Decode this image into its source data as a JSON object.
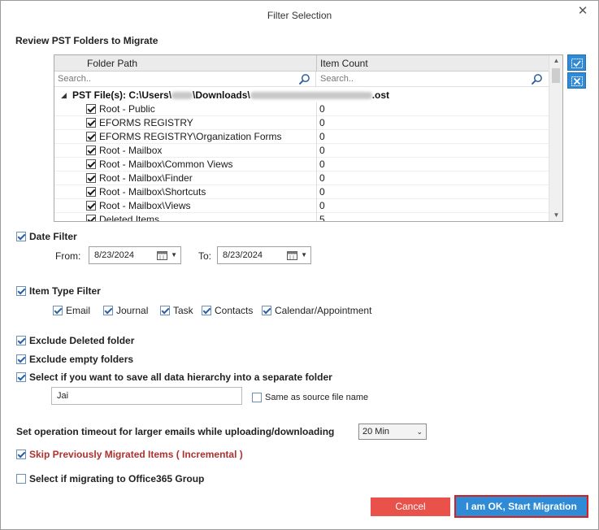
{
  "dialog": {
    "title": "Filter Selection",
    "close_glyph": "✕"
  },
  "review": {
    "title": "Review PST Folders to Migrate",
    "columns": {
      "folder": "Folder Path",
      "count": "Item Count"
    },
    "search_placeholder_folder": "Search..",
    "search_placeholder_count": "Search..",
    "root_label": "PST File(s): C:\\Users\\",
    "root_mid": "\\Downloads\\",
    "root_ext": ".ost",
    "rows": [
      {
        "name": "Root - Public",
        "count": "0",
        "checked": true
      },
      {
        "name": "EFORMS REGISTRY",
        "count": "0",
        "checked": true
      },
      {
        "name": "EFORMS REGISTRY\\Organization Forms",
        "count": "0",
        "checked": true
      },
      {
        "name": "Root - Mailbox",
        "count": "0",
        "checked": true
      },
      {
        "name": "Root - Mailbox\\Common Views",
        "count": "0",
        "checked": true
      },
      {
        "name": "Root - Mailbox\\Finder",
        "count": "0",
        "checked": true
      },
      {
        "name": "Root - Mailbox\\Shortcuts",
        "count": "0",
        "checked": true
      },
      {
        "name": "Root - Mailbox\\Views",
        "count": "0",
        "checked": true
      },
      {
        "name": "Deleted Items",
        "count": "5",
        "checked": true
      }
    ],
    "side_buttons": {
      "select_all": "check-all-icon",
      "deselect_all": "uncheck-all-icon"
    }
  },
  "date_filter": {
    "label": "Date Filter",
    "checked": true,
    "from_label": "From:",
    "from_value": "8/23/2024",
    "to_label": "To:",
    "to_value": "8/23/2024"
  },
  "item_type_filter": {
    "label": "Item Type Filter",
    "checked": true,
    "types": [
      {
        "label": "Email",
        "checked": true
      },
      {
        "label": "Journal",
        "checked": true
      },
      {
        "label": "Task",
        "checked": true
      },
      {
        "label": "Contacts",
        "checked": true
      },
      {
        "label": "Calendar/Appointment",
        "checked": true
      }
    ]
  },
  "options": {
    "exclude_deleted": "Exclude Deleted folder",
    "exclude_empty": "Exclude empty folders",
    "save_hierarchy": "Select if you want to save all data hierarchy into a separate folder",
    "folder_name_value": "Jai",
    "same_as_source": "Same as source file name",
    "timeout_label": "Set operation timeout for larger emails while uploading/downloading",
    "timeout_value": "20 Min",
    "skip_migrated": "Skip Previously Migrated Items ( Incremental )",
    "office365_group": "Select if migrating to Office365 Group"
  },
  "buttons": {
    "cancel": "Cancel",
    "start": "I am OK, Start Migration"
  },
  "colors": {
    "accent_blue": "#2f8bd6",
    "cancel_red": "#e8524a",
    "highlight_border": "#d62020",
    "incremental_text": "#b03030"
  }
}
